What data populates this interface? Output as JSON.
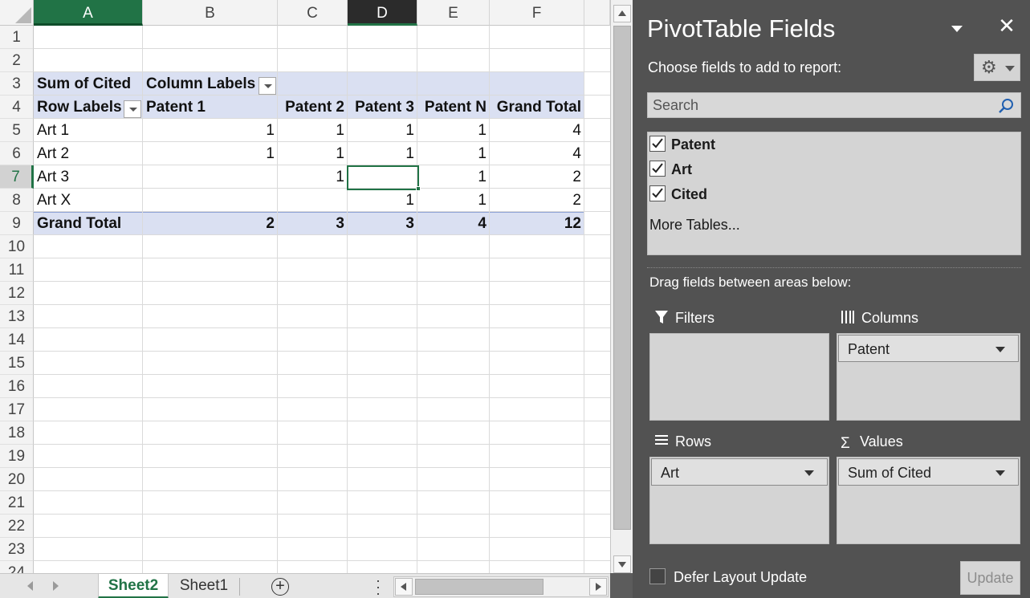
{
  "sheet": {
    "columns": [
      "A",
      "B",
      "C",
      "D",
      "E",
      "F"
    ],
    "rows": [
      "1",
      "2",
      "3",
      "4",
      "5",
      "6",
      "7",
      "8",
      "9",
      "10",
      "11",
      "12",
      "13",
      "14",
      "15",
      "16",
      "17",
      "18",
      "19",
      "20",
      "21",
      "22",
      "23",
      "24"
    ],
    "selected_column": "D",
    "selected_row": "7",
    "pivot": {
      "value_field_label": "Sum of Cited",
      "column_labels_header": "Column Labels",
      "row_labels_header": "Row Labels",
      "column_headers": [
        "Patent 1",
        "Patent 2",
        "Patent 3",
        "Patent N",
        "Grand Total"
      ],
      "rows": [
        {
          "label": "Art 1",
          "values": [
            "1",
            "1",
            "1",
            "1",
            "4"
          ]
        },
        {
          "label": "Art 2",
          "values": [
            "1",
            "1",
            "1",
            "1",
            "4"
          ]
        },
        {
          "label": "Art 3",
          "values": [
            "",
            "1",
            "",
            "1",
            "2"
          ]
        },
        {
          "label": "Art X",
          "values": [
            "",
            "",
            "1",
            "1",
            "2"
          ]
        }
      ],
      "grand_total": {
        "label": "Grand Total",
        "values": [
          "2",
          "3",
          "3",
          "4",
          "12"
        ]
      }
    },
    "tabs": [
      {
        "label": "Sheet2",
        "active": true
      },
      {
        "label": "Sheet1",
        "active": false
      }
    ],
    "add_sheet_icon": "plus-circle-icon",
    "accent_color": "#217346"
  },
  "pivot_panel": {
    "title": "PivotTable Fields",
    "choose_label": "Choose fields to add to report:",
    "search_placeholder": "Search",
    "fields": [
      {
        "label": "Patent",
        "checked": true
      },
      {
        "label": "Art",
        "checked": true
      },
      {
        "label": "Cited",
        "checked": true
      }
    ],
    "more_tables": "More Tables...",
    "drag_label": "Drag fields between areas below:",
    "areas": {
      "filters": {
        "label": "Filters",
        "items": []
      },
      "columns": {
        "label": "Columns",
        "items": [
          "Patent"
        ]
      },
      "rows": {
        "label": "Rows",
        "items": [
          "Art"
        ]
      },
      "values": {
        "label": "Values",
        "items": [
          "Sum of Cited"
        ]
      }
    },
    "defer_label": "Defer Layout Update",
    "update_label": "Update"
  }
}
